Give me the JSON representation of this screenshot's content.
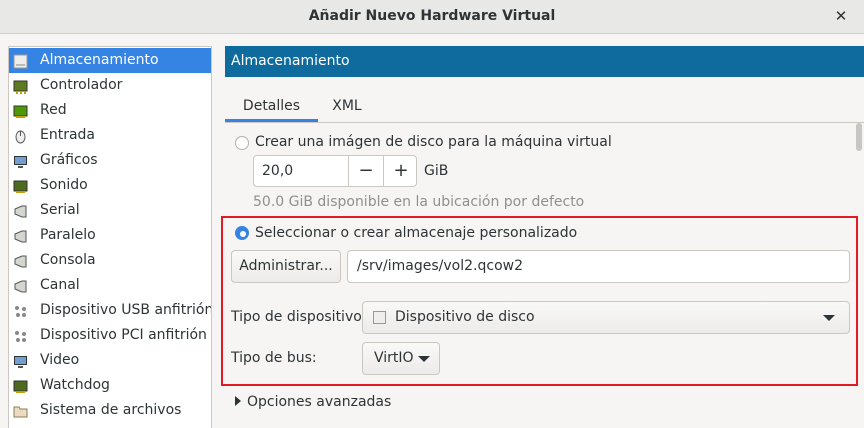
{
  "window": {
    "title": "Añadir Nuevo Hardware Virtual",
    "close_glyph": "✕"
  },
  "sidebar": {
    "items": [
      {
        "label": "Almacenamiento",
        "icon": "disk-icon",
        "selected": true
      },
      {
        "label": "Controlador",
        "icon": "controller-icon"
      },
      {
        "label": "Red",
        "icon": "network-icon"
      },
      {
        "label": "Entrada",
        "icon": "mouse-icon"
      },
      {
        "label": "Gráficos",
        "icon": "monitor-icon"
      },
      {
        "label": "Sonido",
        "icon": "sound-card-icon"
      },
      {
        "label": "Serial",
        "icon": "serial-port-icon"
      },
      {
        "label": "Paralelo",
        "icon": "parallel-port-icon"
      },
      {
        "label": "Consola",
        "icon": "console-icon"
      },
      {
        "label": "Canal",
        "icon": "channel-icon"
      },
      {
        "label": "Dispositivo USB anfitrión",
        "icon": "usb-device-icon"
      },
      {
        "label": "Dispositivo PCI anfitrión",
        "icon": "pci-device-icon"
      },
      {
        "label": "Video",
        "icon": "video-icon"
      },
      {
        "label": "Watchdog",
        "icon": "watchdog-icon"
      },
      {
        "label": "Sistema de archivos",
        "icon": "filesystem-icon"
      }
    ]
  },
  "header": {
    "title": "Almacenamiento"
  },
  "tabs": [
    {
      "label": "Detalles",
      "active": true
    },
    {
      "label": "XML"
    }
  ],
  "storage": {
    "create_option": {
      "label": "Crear una imágen de disco para la máquina virtual",
      "checked": false
    },
    "size": {
      "value": "20,0",
      "unit": "GiB",
      "minus": "−",
      "plus": "+"
    },
    "available_text": "50.0 GiB disponible en la ubicación por defecto",
    "custom_option": {
      "label": "Seleccionar o crear almacenaje personalizado",
      "checked": true
    },
    "manage_button": "Administrar...",
    "path": "/srv/images/vol2.qcow2",
    "device_type": {
      "label": "Tipo de dispositivo:",
      "value": "Dispositivo de disco"
    },
    "bus_type": {
      "label": "Tipo de bus:",
      "value": "VirtIO"
    },
    "advanced": {
      "label": "Opciones avanzadas",
      "expanded": false
    }
  },
  "colors": {
    "accent": "#3584e4",
    "header": "#0f6b9e",
    "highlight_box": "#e01b24"
  }
}
